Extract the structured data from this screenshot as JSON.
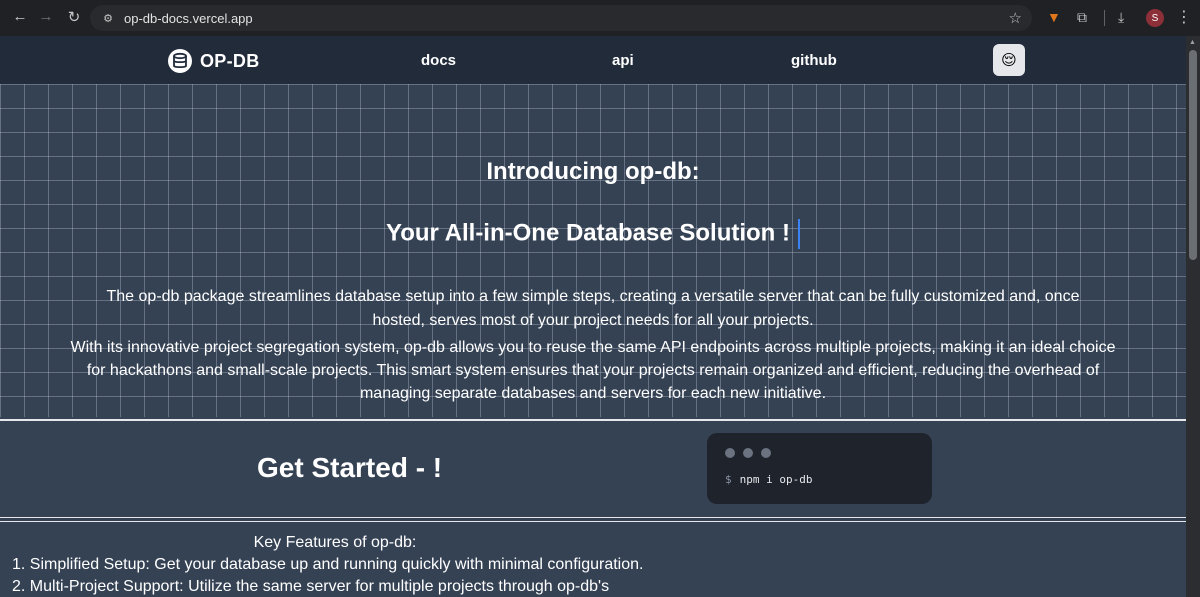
{
  "browser": {
    "url": "op-db-docs.vercel.app",
    "profile_initial": "S",
    "icons": [
      "back-icon",
      "forward-icon",
      "reload-icon",
      "site-info-icon",
      "star-icon",
      "metamask-icon",
      "extensions-icon",
      "download-icon",
      "menu-icon"
    ]
  },
  "nav": {
    "brand": "OP-DB",
    "links": [
      "docs",
      "api",
      "github"
    ],
    "theme_icon": "😌"
  },
  "hero": {
    "title": "Introducing op-db:",
    "subtitle": "Your All-in-One Database Solution !",
    "paragraph1": "The op-db package streamlines database setup into a few simple steps, creating a versatile server that can be fully customized and, once hosted, serves most of your project needs for all your projects.",
    "paragraph2": "With its innovative project segregation system, op-db allows you to reuse the same API endpoints across multiple projects, making it an ideal choice for hackathons and small-scale projects. This smart system ensures that your projects remain organized and efficient, reducing the overhead of managing separate databases and servers for each new initiative."
  },
  "get_started": {
    "heading": "Get Started - !",
    "terminal": {
      "prompt": "$",
      "command": "npm i op-db"
    }
  },
  "features": {
    "title": "Key Features of op-db:",
    "items": [
      "1. Simplified Setup: Get your database up and running quickly with minimal configuration.",
      "2. Multi-Project Support: Utilize the same server for multiple projects through op-db's"
    ]
  },
  "colors": {
    "page_bg": "#354254",
    "nav_bg": "#212b3a",
    "terminal_bg": "#1e232c",
    "caret": "#3b82f6"
  }
}
